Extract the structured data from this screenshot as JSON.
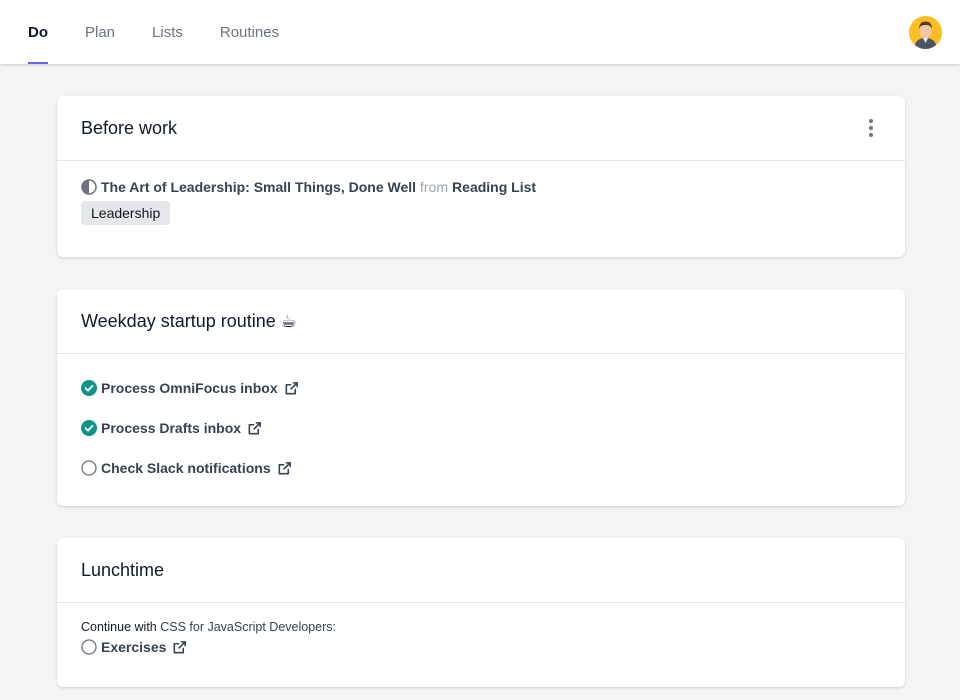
{
  "nav": {
    "tabs": [
      {
        "label": "Do",
        "active": true
      },
      {
        "label": "Plan",
        "active": false
      },
      {
        "label": "Lists",
        "active": false
      },
      {
        "label": "Routines",
        "active": false
      }
    ],
    "avatar": "user-avatar"
  },
  "cards": {
    "before_work": {
      "title": "Before work",
      "item": {
        "title": "The Art of Leadership: Small Things, Done Well",
        "from": "from",
        "list": "Reading List",
        "tag": "Leadership",
        "status_icon": "half-circle-icon"
      }
    },
    "weekday": {
      "title": "Weekday startup routine ☕",
      "items": [
        {
          "label": "Process OmniFocus inbox",
          "done": true
        },
        {
          "label": "Process Drafts inbox",
          "done": true
        },
        {
          "label": "Check Slack notifications",
          "done": false
        }
      ]
    },
    "lunchtime": {
      "title": "Lunchtime",
      "note_prefix": "Continue with",
      "note_link": "CSS for JavaScript Developers:",
      "items": [
        {
          "label": "Exercises",
          "done": false
        }
      ]
    }
  },
  "colors": {
    "accent": "#6366f1",
    "check": "#0d9488",
    "avatar_bg": "#fbbf24"
  }
}
